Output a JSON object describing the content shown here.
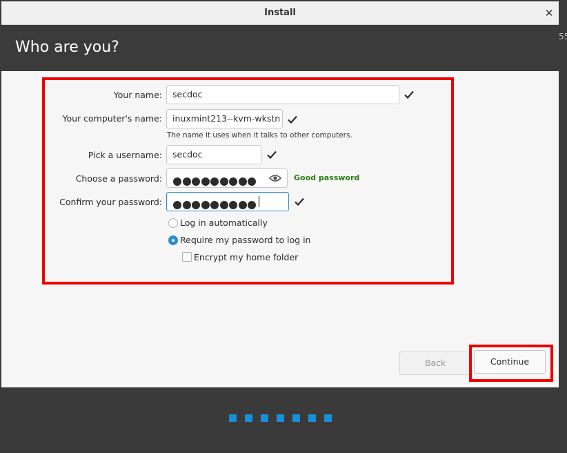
{
  "window": {
    "title": "Install",
    "heading": "Who are you?"
  },
  "background_fragment": "55",
  "form": {
    "name_label": "Your name:",
    "name_value": "secdoc",
    "computer_label": "Your computer's name:",
    "computer_value": "inuxmint213--kvm-wkstn",
    "computer_hint": "The name it uses when it talks to other computers.",
    "username_label": "Pick a username:",
    "username_value": "secdoc",
    "password_label": "Choose a password:",
    "password_dot_count": 9,
    "password_strength": "Good password",
    "confirm_label": "Confirm your password:",
    "confirm_dot_count": 9
  },
  "options": {
    "auto_login_label": "Log in automatically",
    "auto_login_selected": false,
    "require_password_label": "Require my password to log in",
    "require_password_selected": true,
    "encrypt_label": "Encrypt my home folder",
    "encrypt_checked": false
  },
  "buttons": {
    "back": "Back",
    "continue": "Continue"
  },
  "progress": {
    "step_count": 7
  },
  "colors": {
    "accent": "#2a8fd0",
    "highlight": "#ee0000",
    "strength_good": "#2a7b12",
    "progress": "#1b8fd6"
  },
  "icons": {
    "check": "checkmark-icon",
    "eye": "eye-icon",
    "close": "close-icon"
  }
}
